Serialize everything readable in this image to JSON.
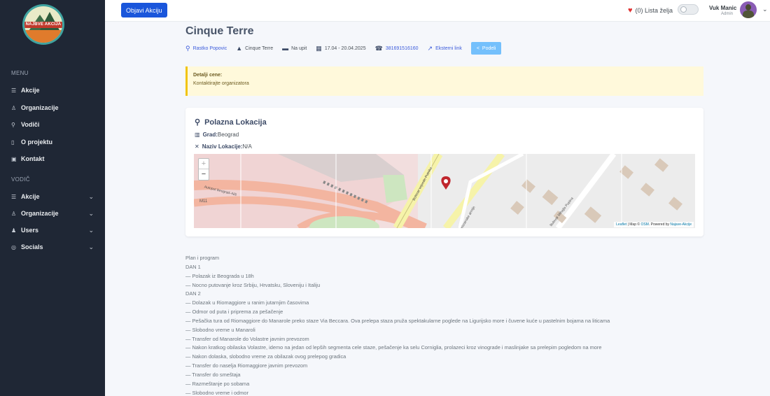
{
  "sidebar": {
    "logo_text": "NAJBVE AKCIJA",
    "section1": "MENU",
    "menu": [
      {
        "label": "Akcije",
        "icon": "sliders-icon"
      },
      {
        "label": "Organizacije",
        "icon": "users-icon"
      },
      {
        "label": "Vodiči",
        "icon": "hiker-icon"
      },
      {
        "label": "O projektu",
        "icon": "document-icon"
      },
      {
        "label": "Kontakt",
        "icon": "contact-icon"
      }
    ],
    "section2": "VODIČ",
    "vodic": [
      {
        "label": "Akcije",
        "icon": "sliders-icon"
      },
      {
        "label": "Organizacije",
        "icon": "users-icon"
      },
      {
        "label": "Users",
        "icon": "user-group-icon"
      },
      {
        "label": "Socials",
        "icon": "instagram-icon"
      }
    ]
  },
  "topbar": {
    "publish_button": "Objavi Akciju",
    "wishlist": "(0) Lista želja",
    "user_name": "Vuk Manic",
    "user_role": "Admin"
  },
  "event": {
    "title": "Cinque Terre",
    "organizer": "Rastko Popovic",
    "location": "Cinque Terre",
    "price": "Na upit",
    "dates": "17.04 - 20.04.2025",
    "phone": "381691516160",
    "external_link": "Eksterni link",
    "share": "Podeli"
  },
  "price_alert": {
    "title": "Detalji cene:",
    "text": "Kontaktirajte organizatora"
  },
  "departure": {
    "title": "Polazna Lokacija",
    "city_label": "Grad:",
    "city_value": "Beograd",
    "location_label": "Naziv Lokacije:",
    "location_value": "N/A"
  },
  "map": {
    "road_label_1": "Bulevar vojvode Putnika",
    "road_label_2": "Autoput Beograd–Niš",
    "road_label_3": "Bulevar Mihajla Pupina",
    "road_label_4": "M11",
    "road_label_5": "Partizanske armije",
    "attribution_leaflet": "Leaflet",
    "attribution_mid": "| Map ©",
    "attribution_osm": "OSM",
    "attribution_powered": ". Powered by",
    "attribution_site": "Najave-Akcije"
  },
  "program": [
    "Plan i program",
    "DAN 1",
    "— Polazak iz Beograda u 18h",
    "— Nocno putovanje kroz Srbiju, Hrvatsku, Sloveniju i Italiju",
    "DAN 2",
    "— Dolazak u Riomaggiore u ranim jutarnjim časovima",
    "— Odmor od puta i priprema za pešačenje",
    "— Pešačka tura od Riomaggiore do Manarole preko staze Via Beccara. Ova prelepa staza pruža spektakularne poglede na Ligurijsko more i čuvene kuće u pastelnim bojama na liticama",
    "— Slobodno vreme u Manaroli",
    "— Transfer od Manarole do Volastre javnim prevozom",
    "— Nakon kratkog obilaska Volastre, idemo na jedan od lepših segmenta cele staze, pešačenje ka selu Corniglia, prolazeci kroz vinograde i maslinjake sa prelepim pogledom na more",
    "— Nakon dolaska, slobodno vreme za obilazak ovog prelepog gradica",
    "— Transfer do naselja Riomaggiore javnim prevozom",
    "— Transfer do smeštaja",
    "— Razmeštanje po sobama",
    "— Slobodno vreme i odmor"
  ],
  "colors": {
    "sidebar_bg": "#1f2735",
    "primary": "#1a56db",
    "share": "#74c0fc",
    "alert_bg": "#fff9db",
    "alert_border": "#f1c40f"
  }
}
